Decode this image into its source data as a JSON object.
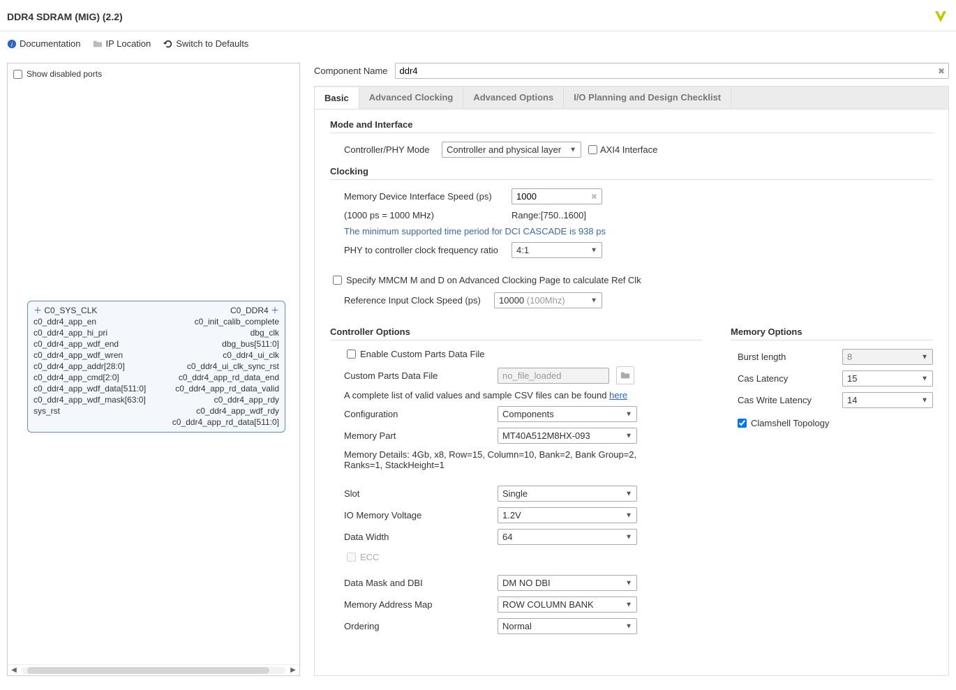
{
  "header": {
    "title": "DDR4 SDRAM (MIG) (2.2)"
  },
  "toolbar": {
    "documentation": "Documentation",
    "ip_location": "IP Location",
    "switch_defaults": "Switch to Defaults"
  },
  "left": {
    "show_disabled_ports_label": "Show disabled ports",
    "block": {
      "left_iface": "C0_SYS_CLK",
      "right_iface": "C0_DDR4",
      "left_ports": [
        "c0_ddr4_app_en",
        "c0_ddr4_app_hi_pri",
        "c0_ddr4_app_wdf_end",
        "c0_ddr4_app_wdf_wren",
        "c0_ddr4_app_addr[28:0]",
        "c0_ddr4_app_cmd[2:0]",
        "c0_ddr4_app_wdf_data[511:0]",
        "c0_ddr4_app_wdf_mask[63:0]",
        "sys_rst"
      ],
      "right_ports": [
        "c0_init_calib_complete",
        "dbg_clk",
        "dbg_bus[511:0]",
        "c0_ddr4_ui_clk",
        "c0_ddr4_ui_clk_sync_rst",
        "c0_ddr4_app_rd_data_end",
        "c0_ddr4_app_rd_data_valid",
        "c0_ddr4_app_rdy",
        "c0_ddr4_app_wdf_rdy",
        "c0_ddr4_app_rd_data[511:0]"
      ]
    }
  },
  "componentNameLabel": "Component Name",
  "componentName": "ddr4",
  "tabs": [
    "Basic",
    "Advanced Clocking",
    "Advanced Options",
    "I/O Planning and Design Checklist"
  ],
  "sections": {
    "mode": {
      "title": "Mode and Interface",
      "ctrl_phy_label": "Controller/PHY Mode",
      "ctrl_phy_value": "Controller and physical layer",
      "axi4_label": "AXI4 Interface"
    },
    "clocking": {
      "title": "Clocking",
      "speed_label": "Memory Device Interface Speed (ps)",
      "speed_value": "1000",
      "speed_note_left": "(1000 ps = 1000 MHz)",
      "speed_note_right": "Range:[750..1600]",
      "dci_note": "The minimum supported time period for DCI CASCADE is 938 ps",
      "ratio_label": "PHY to controller clock frequency ratio",
      "ratio_value": "4:1",
      "mmcm_label": "Specify MMCM M and D on Advanced Clocking Page to calculate Ref Clk",
      "ref_label": "Reference Input Clock Speed (ps)",
      "ref_value": "10000",
      "ref_hint": "(100Mhz)"
    },
    "ctrl": {
      "title": "Controller Options",
      "enable_custom_label": "Enable Custom Parts Data File",
      "custom_file_label": "Custom Parts Data File",
      "custom_file_value": "no_file_loaded",
      "csv_note_a": "A complete list of valid values and sample CSV files can be found ",
      "csv_link": "here",
      "configuration_label": "Configuration",
      "configuration_value": "Components",
      "mempart_label": "Memory Part",
      "mempart_value": "MT40A512M8HX-093",
      "mempart_details": "Memory Details: 4Gb, x8, Row=15, Column=10, Bank=2, Bank Group=2, Ranks=1, StackHeight=1",
      "slot_label": "Slot",
      "slot_value": "Single",
      "voltage_label": "IO Memory Voltage",
      "voltage_value": "1.2V",
      "datawidth_label": "Data Width",
      "datawidth_value": "64",
      "ecc_label": "ECC",
      "dmdbi_label": "Data Mask and DBI",
      "dmdbi_value": "DM NO DBI",
      "addrmap_label": "Memory Address Map",
      "addrmap_value": "ROW COLUMN BANK",
      "ordering_label": "Ordering",
      "ordering_value": "Normal"
    },
    "memopts": {
      "title": "Memory Options",
      "burst_label": "Burst length",
      "burst_value": "8",
      "cas_label": "Cas Latency",
      "cas_value": "15",
      "caswr_label": "Cas Write Latency",
      "caswr_value": "14",
      "clamshell_label": "Clamshell Topology"
    }
  }
}
